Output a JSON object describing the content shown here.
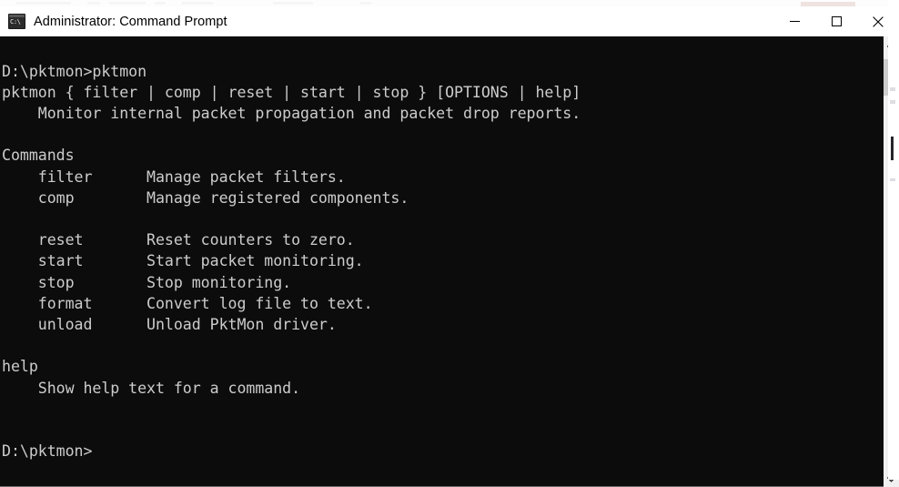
{
  "window": {
    "title": "Administrator: Command Prompt",
    "icon": "cmd-console-icon",
    "icon_text": "C:\\",
    "controls": {
      "minimize": "Minimize",
      "maximize": "Maximize",
      "close": "Close"
    },
    "colors": {
      "titlebar_background": "#ffffff",
      "title_text": "#000000",
      "console_background": "#0c0c0c",
      "console_text": "#cccccc",
      "scrollbar_track": "#f0f0f0",
      "scrollbar_thumb": "#cdcdcd"
    }
  },
  "console": {
    "prompt_path": "D:\\pktmon>",
    "entered_command": "pktmon",
    "text": "D:\\pktmon>pktmon\npktmon { filter | comp | reset | start | stop } [OPTIONS | help]\n    Monitor internal packet propagation and packet drop reports.\n\nCommands\n    filter      Manage packet filters.\n    comp        Manage registered components.\n\n    reset       Reset counters to zero.\n    start       Start packet monitoring.\n    stop        Stop monitoring.\n    format      Convert log file to text.\n    unload      Unload PktMon driver.\n\nhelp\n    Show help text for a command.\n\n\nD:\\pktmon>",
    "usage_line": "pktmon { filter | comp | reset | start | stop } [OPTIONS | help]",
    "usage_description": "Monitor internal packet propagation and packet drop reports.",
    "commands_heading": "Commands",
    "commands": [
      {
        "name": "filter",
        "description": "Manage packet filters."
      },
      {
        "name": "comp",
        "description": "Manage registered components."
      },
      {
        "name": "reset",
        "description": "Reset counters to zero."
      },
      {
        "name": "start",
        "description": "Start packet monitoring."
      },
      {
        "name": "stop",
        "description": "Stop monitoring."
      },
      {
        "name": "format",
        "description": "Convert log file to text."
      },
      {
        "name": "unload",
        "description": "Unload PktMon driver."
      }
    ],
    "help_heading": "help",
    "help_description": "Show help text for a command.",
    "trailing_prompt": "D:\\pktmon>"
  },
  "scrollbar": {
    "up_arrow": "chevron-up-icon",
    "down_arrow": "chevron-down-icon",
    "thumb_label": "scrollbar-thumb"
  }
}
